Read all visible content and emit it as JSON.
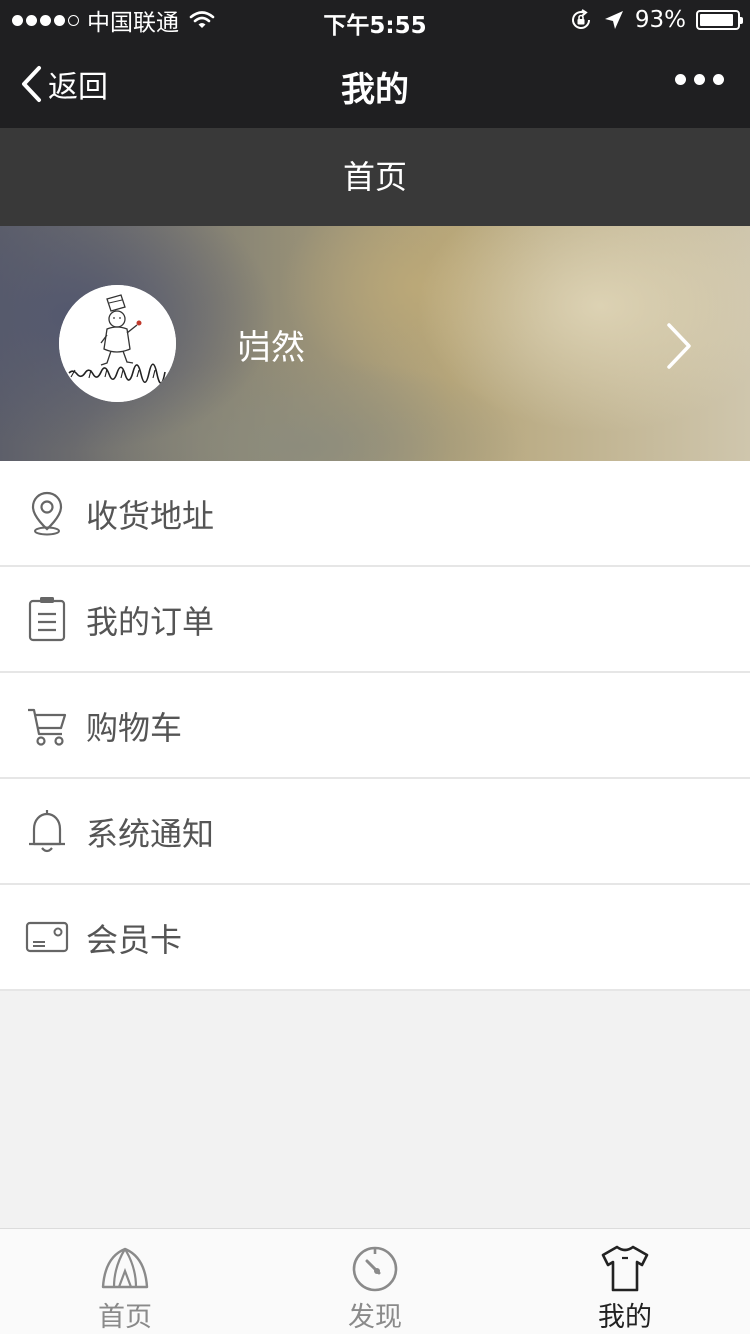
{
  "status_bar": {
    "carrier": "中国联通",
    "time": "下午5:55",
    "battery_percent": "93%",
    "battery_level": 0.93
  },
  "nav": {
    "back_label": "返回",
    "title": "我的"
  },
  "sub_header": {
    "title": "首页"
  },
  "profile": {
    "name": "岿然"
  },
  "menu": {
    "items": [
      {
        "label": "收货地址",
        "icon": "location-icon"
      },
      {
        "label": "我的订单",
        "icon": "clipboard-icon"
      },
      {
        "label": "购物车",
        "icon": "cart-icon"
      },
      {
        "label": "系统通知",
        "icon": "bell-icon"
      },
      {
        "label": "会员卡",
        "icon": "card-icon"
      }
    ]
  },
  "tabs": [
    {
      "label": "首页",
      "icon": "tent-icon",
      "active": false
    },
    {
      "label": "发现",
      "icon": "compass-icon",
      "active": false
    },
    {
      "label": "我的",
      "icon": "shirt-icon",
      "active": true
    }
  ],
  "colors": {
    "nav_bg": "#1f1f21",
    "sub_header_bg": "#393939",
    "page_bg": "#f2f2f2",
    "menu_text": "#555555",
    "tab_inactive": "#8a8a8a",
    "tab_active": "#222222"
  }
}
